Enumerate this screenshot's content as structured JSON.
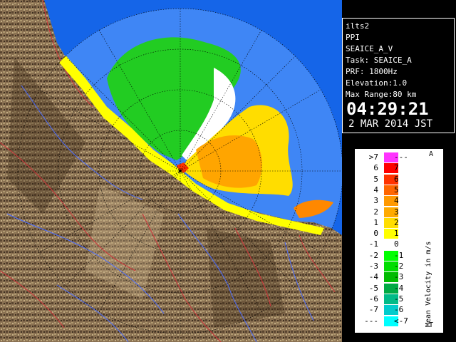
{
  "info": {
    "lines": [
      "ilts2",
      "PPI",
      "SEAICE_A_V",
      "Task: SEAICE_A",
      "PRF: 1800Hz",
      "Elevation:1.0",
      "Max Range:80 km"
    ],
    "time": "04:29:21",
    "date": "2 MAR 2014 JST"
  },
  "legend": {
    "title": "Mean Velocity in m/s",
    "top_marker": "A",
    "bottom_marker": "T",
    "rows": [
      {
        "left": ">7",
        "right": "---",
        "color": "#ff33ff"
      },
      {
        "left": "6",
        "right": "7",
        "color": "#ff0000"
      },
      {
        "left": "5",
        "right": "6",
        "color": "#ff3300"
      },
      {
        "left": "4",
        "right": "5",
        "color": "#ff6600"
      },
      {
        "left": "3",
        "right": "4",
        "color": "#ff9900"
      },
      {
        "left": "2",
        "right": "3",
        "color": "#ffaa00"
      },
      {
        "left": "1",
        "right": "2",
        "color": "#ffdd00"
      },
      {
        "left": "0",
        "right": "1",
        "color": "#ffff00"
      },
      {
        "left": "-1",
        "right": "0",
        "color": "#ffffff"
      },
      {
        "left": "-2",
        "right": "-1",
        "color": "#00ff00"
      },
      {
        "left": "-3",
        "right": "-2",
        "color": "#00dd00"
      },
      {
        "left": "-4",
        "right": "-3",
        "color": "#00bb00"
      },
      {
        "left": "-5",
        "right": "-4",
        "color": "#00aa44"
      },
      {
        "left": "-6",
        "right": "-5",
        "color": "#00bb88"
      },
      {
        "left": "-7",
        "right": "-6",
        "color": "#00cccc"
      },
      {
        "left": "---",
        "right": "<-7",
        "color": "#00ffff"
      }
    ]
  },
  "colors": {
    "sea": "#1565e8",
    "coverage": "#3f86f5",
    "land": "#8a7152",
    "green": "#22cc22",
    "yellow": "#ffdd00",
    "orange": "#ff9900"
  }
}
